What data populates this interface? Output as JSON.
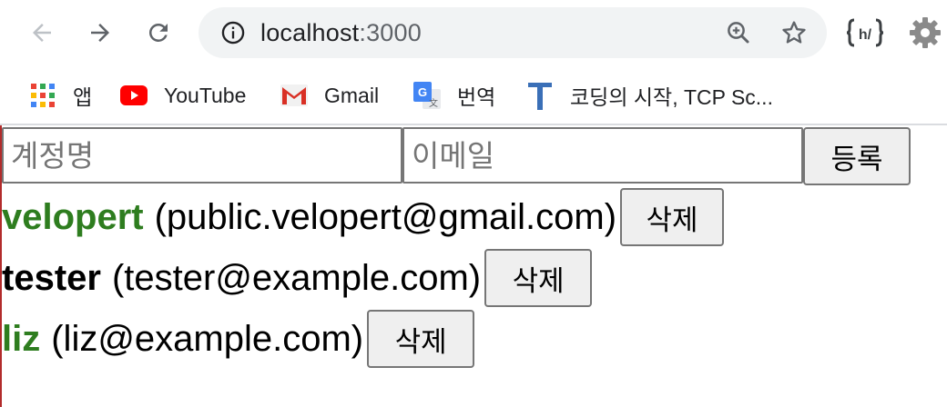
{
  "browser": {
    "url_host": "localhost",
    "url_port": ":3000",
    "colors": {
      "omnibox_bg": "#f1f3f4",
      "icon": "#5f6368"
    }
  },
  "bookmarks": [
    {
      "label": "앱",
      "icon": "apps-grid-icon"
    },
    {
      "label": "YouTube",
      "icon": "youtube-icon"
    },
    {
      "label": "Gmail",
      "icon": "gmail-icon"
    },
    {
      "label": "번역",
      "icon": "google-translate-icon"
    },
    {
      "label": "코딩의 시작, TCP Sc...",
      "icon": "tcp-school-icon"
    }
  ],
  "form": {
    "username_placeholder": "계정명",
    "email_placeholder": "이메일",
    "username_value": "",
    "email_value": "",
    "submit_label": "등록"
  },
  "users": [
    {
      "username": "velopert",
      "email": "(public.velopert@gmail.com)",
      "active": true,
      "delete_label": "삭제"
    },
    {
      "username": "tester",
      "email": "(tester@example.com)",
      "active": false,
      "delete_label": "삭제"
    },
    {
      "username": "liz",
      "email": "(liz@example.com)",
      "active": true,
      "delete_label": "삭제"
    }
  ],
  "colors": {
    "active_user": "#2e7d1f",
    "inactive_user": "#000000"
  }
}
